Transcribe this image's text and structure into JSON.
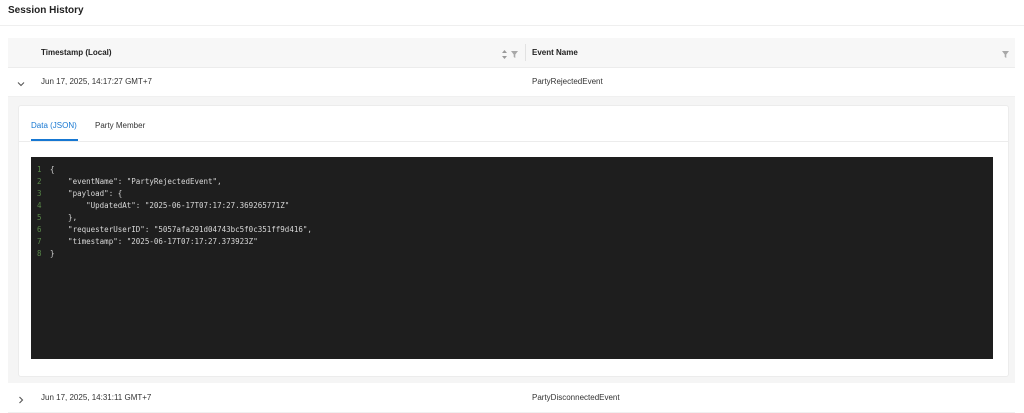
{
  "page": {
    "title": "Session History"
  },
  "table": {
    "columns": [
      {
        "label": "Timestamp (Local)"
      },
      {
        "label": "Event Name"
      }
    ],
    "rows": [
      {
        "timestamp": "Jun 17, 2025, 14:17:27 GMT+7",
        "event": "PartyRejectedEvent",
        "expanded": true
      },
      {
        "timestamp": "Jun 17, 2025, 14:31:11 GMT+7",
        "event": "PartyDisconnectedEvent",
        "expanded": false
      }
    ]
  },
  "details": {
    "tabs": [
      {
        "label": "Data (JSON)",
        "active": true
      },
      {
        "label": "Party Member",
        "active": false
      }
    ],
    "code_lines": [
      {
        "n": "1",
        "text": "{"
      },
      {
        "n": "2",
        "text": "    \"eventName\": \"PartyRejectedEvent\","
      },
      {
        "n": "3",
        "text": "    \"payload\": {"
      },
      {
        "n": "4",
        "text": "        \"UpdatedAt\": \"2025-06-17T07:17:27.369265771Z\""
      },
      {
        "n": "5",
        "text": "    },"
      },
      {
        "n": "6",
        "text": "    \"requesterUserID\": \"5057afa291d04743bc5f0c351ff9d416\","
      },
      {
        "n": "7",
        "text": "    \"timestamp\": \"2025-06-17T07:17:27.373923Z\""
      },
      {
        "n": "8",
        "text": "}"
      }
    ]
  },
  "icons": {
    "sort": "sort-icon",
    "filter": "filter-icon",
    "expand": "chevron-right-icon",
    "collapse": "chevron-down-icon"
  },
  "colors": {
    "accent": "#1677d2",
    "code_bg": "#1e1e1e",
    "line_numbers": "#5a8a4a"
  }
}
